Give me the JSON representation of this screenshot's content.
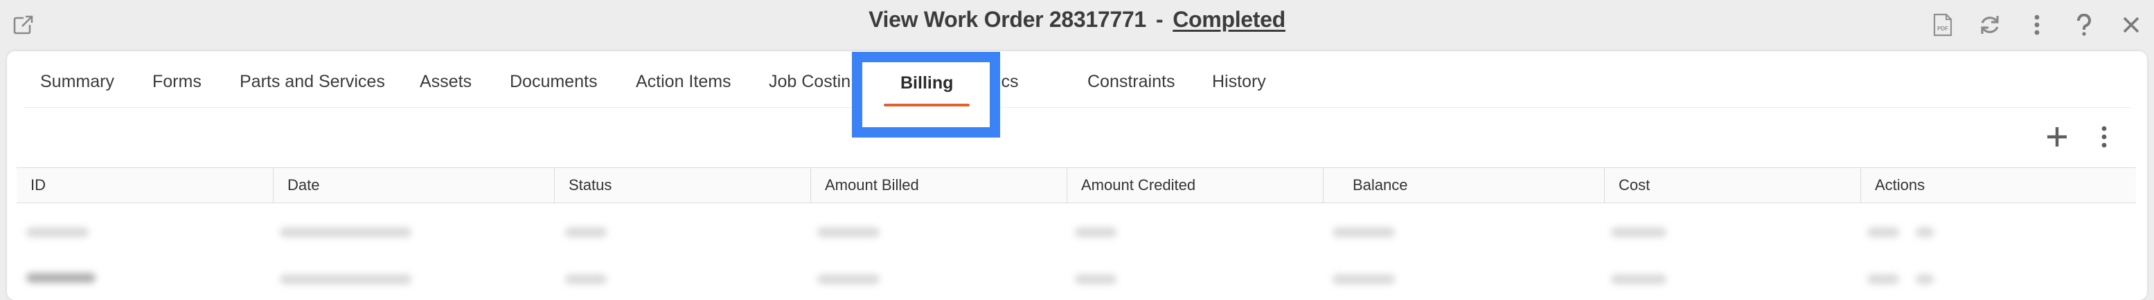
{
  "window": {
    "title_prefix": "View Work Order",
    "order_number": "28317771",
    "separator": "-",
    "status": "Completed"
  },
  "title_icons": [
    "popout-icon",
    "pdf-icon",
    "refresh-icon",
    "more-vertical-icon",
    "help-icon",
    "close-icon"
  ],
  "tabs": [
    {
      "label": "Summary"
    },
    {
      "label": "Forms"
    },
    {
      "label": "Parts and Services"
    },
    {
      "label": "Assets"
    },
    {
      "label": "Documents"
    },
    {
      "label": "Action Items"
    },
    {
      "label": "Job Costin"
    },
    {
      "label": "Billing",
      "active": true
    },
    {
      "label": "Metrics"
    },
    {
      "label": "Constraints"
    },
    {
      "label": "History"
    }
  ],
  "toolbar_icons": [
    "add-icon",
    "more-vertical-icon"
  ],
  "table": {
    "columns": [
      "ID",
      "Date",
      "Status",
      "Amount Billed",
      "Amount Credited",
      "Balance",
      "Cost",
      "Actions"
    ]
  },
  "colors": {
    "accent_underline": "#e0612b",
    "highlight_box": "#3b82f6"
  }
}
